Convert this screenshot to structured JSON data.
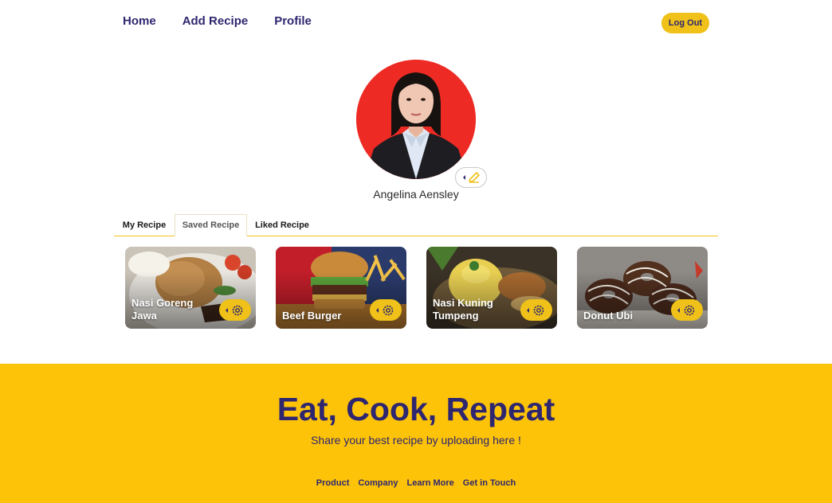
{
  "nav": {
    "home": "Home",
    "add_recipe": "Add Recipe",
    "profile": "Profile",
    "logout": "Log Out"
  },
  "profile": {
    "name": "Angelina Aensley",
    "edit_icon": "pencil-icon"
  },
  "tabs": [
    {
      "label": "My Recipe",
      "active": false
    },
    {
      "label": "Saved Recipe",
      "active": true
    },
    {
      "label": "Liked Recipe",
      "active": false
    }
  ],
  "recipes": [
    {
      "title": "Nasi Goreng Jawa",
      "icon": "gear-icon"
    },
    {
      "title": "Beef Burger",
      "icon": "gear-icon"
    },
    {
      "title": "Nasi Kuning Tumpeng",
      "icon": "gear-icon"
    },
    {
      "title": "Donut Ubi",
      "icon": "gear-icon"
    }
  ],
  "footer": {
    "headline": "Eat, Cook, Repeat",
    "tagline": "Share your best recipe by uploading here !",
    "links": [
      "Product",
      "Company",
      "Learn More",
      "Get in Touch"
    ]
  },
  "colors": {
    "brand": "#2e266f",
    "accent": "#efc119",
    "footer_bg": "#fdc308"
  }
}
